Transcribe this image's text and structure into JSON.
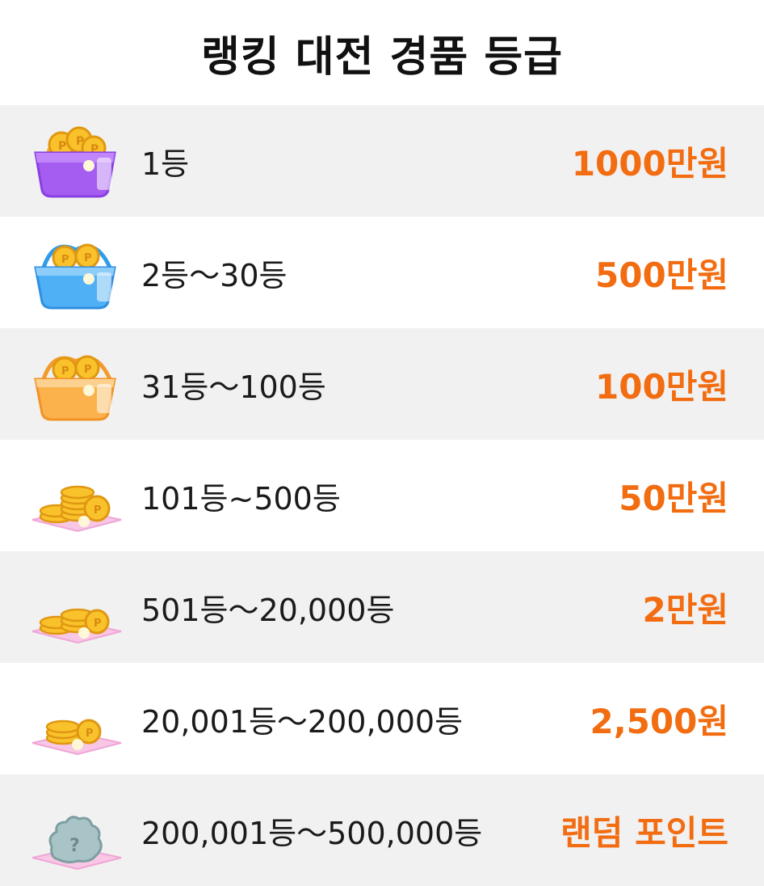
{
  "title": "랭킹 대전 경품 등급",
  "accent_color": "#f26d12",
  "rows": [
    {
      "rank": "1등",
      "prize": "1000만원",
      "icon": "purple-basket-coins-icon"
    },
    {
      "rank": "2등～30등",
      "prize": "500만원",
      "icon": "blue-basket-coins-icon"
    },
    {
      "rank": "31등～100등",
      "prize": "100만원",
      "icon": "orange-basket-coins-icon"
    },
    {
      "rank": "101등~500등",
      "prize": "50만원",
      "icon": "large-coin-stack-icon"
    },
    {
      "rank": "501등～20,000등",
      "prize": "2만원",
      "icon": "medium-coin-stack-icon"
    },
    {
      "rank": "20,001등～200,000등",
      "prize": "2,500원",
      "icon": "small-coin-stack-icon"
    },
    {
      "rank": "200,001등～500,000등",
      "prize": "랜덤 포인트",
      "icon": "mystery-bag-icon"
    }
  ]
}
